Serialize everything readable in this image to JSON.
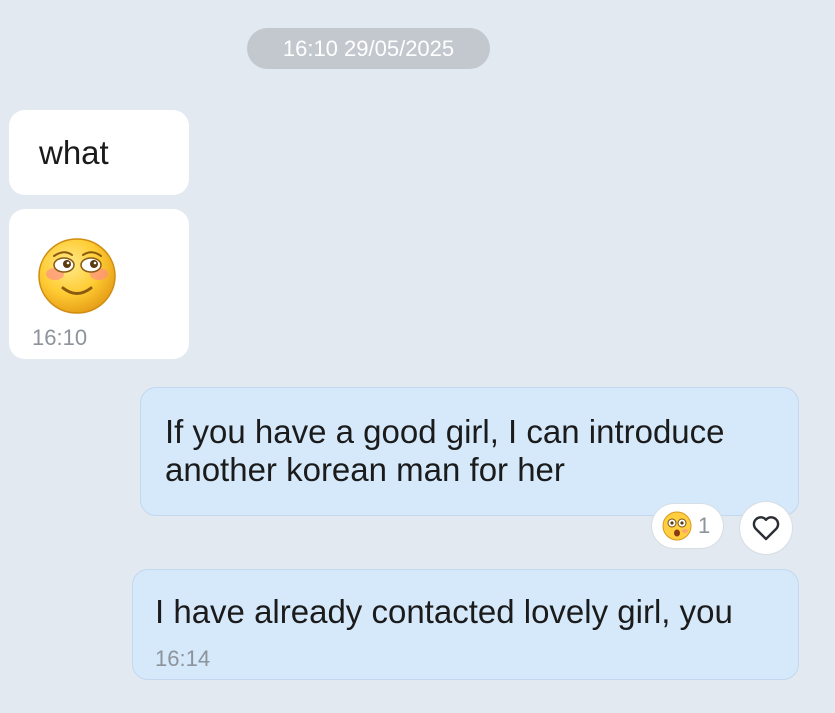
{
  "chat": {
    "date_separator": "16:10 29/05/2025",
    "messages": [
      {
        "direction": "incoming",
        "text": "what",
        "time": ""
      },
      {
        "direction": "incoming",
        "type": "sticker",
        "icon": "blushing-smile-emoji-icon",
        "time": "16:10"
      },
      {
        "direction": "outgoing",
        "text": "If you have a good girl, I can introduce another korean man for her",
        "time": "",
        "reaction": {
          "icon": "surprised-emoji-icon",
          "count": "1"
        },
        "react_button_icon": "heart-outline-icon"
      },
      {
        "direction": "outgoing",
        "text": "I have already contacted lovely girl, you",
        "time": "16:14"
      }
    ]
  },
  "colors": {
    "background": "#e3e9f1",
    "incoming_bubble": "#ffffff",
    "outgoing_bubble": "#d5e9fb",
    "date_pill": "#c3c8cf",
    "time_text": "#8c939b"
  }
}
